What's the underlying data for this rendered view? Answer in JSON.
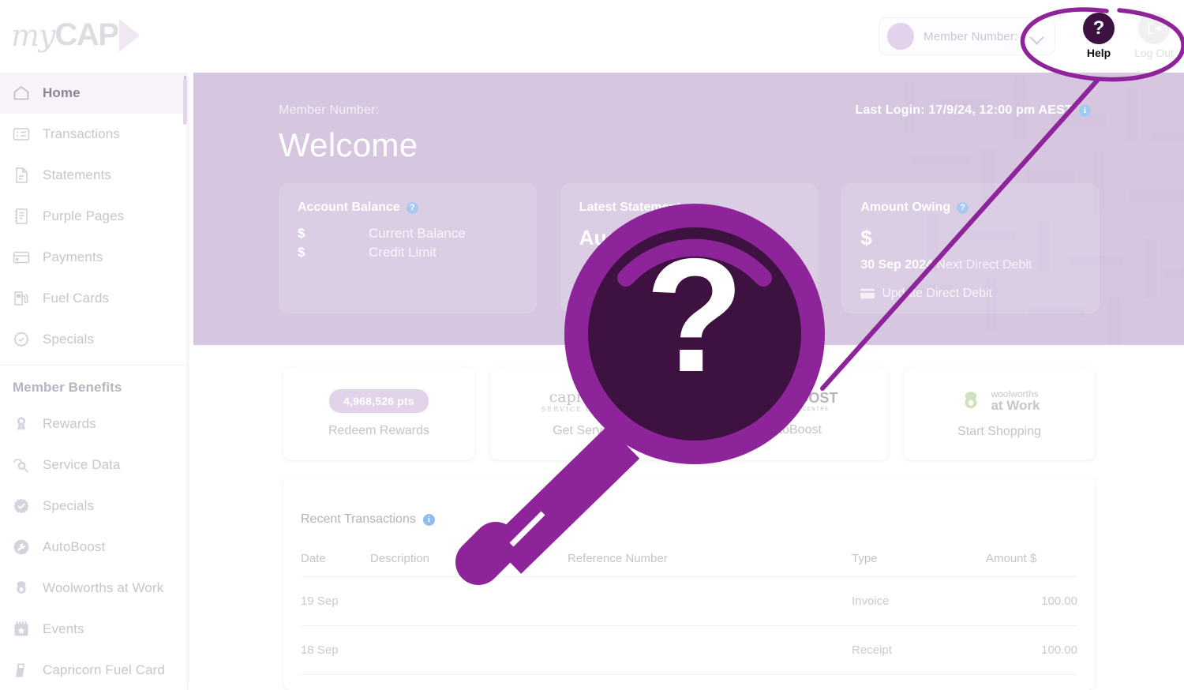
{
  "brand": {
    "logo_my": "my",
    "logo_cap": "CAP",
    "logo_chevron_icon": "chevron-right-icon"
  },
  "header": {
    "member_select": {
      "placeholder": "Member Number:",
      "value": "",
      "chevron_icon": "chevron-down-icon",
      "avatar_icon": "avatar-icon"
    },
    "help": {
      "label": "Help",
      "glyph": "?",
      "icon": "question-mark-icon"
    },
    "logout": {
      "label": "Log Out",
      "icon": "logout-icon"
    }
  },
  "sidebar": {
    "items": [
      {
        "label": "Home",
        "icon": "home-icon",
        "active": true
      },
      {
        "label": "Transactions",
        "icon": "transactions-icon",
        "active": false
      },
      {
        "label": "Statements",
        "icon": "statements-icon",
        "active": false
      },
      {
        "label": "Purple Pages",
        "icon": "purple-pages-icon",
        "active": false
      },
      {
        "label": "Payments",
        "icon": "payments-card-icon",
        "active": false
      },
      {
        "label": "Fuel Cards",
        "icon": "fuel-pump-icon",
        "active": false
      },
      {
        "label": "Specials",
        "icon": "specials-badge-icon",
        "active": false
      }
    ],
    "section_title": "Member Benefits",
    "benefits": [
      {
        "label": "Rewards",
        "icon": "rewards-ribbon-icon"
      },
      {
        "label": "Service Data",
        "icon": "service-data-icon"
      },
      {
        "label": "Specials",
        "icon": "specials-check-icon"
      },
      {
        "label": "AutoBoost",
        "icon": "wrench-icon"
      },
      {
        "label": "Woolworths at Work",
        "icon": "woolworths-icon"
      },
      {
        "label": "Events",
        "icon": "calendar-star-icon"
      },
      {
        "label": "Capricorn Fuel Card",
        "icon": "fuel-card-icon"
      }
    ]
  },
  "banner": {
    "member_number_label": "Member Number:",
    "welcome": "Welcome",
    "last_login": "Last Login: 17/9/24, 12:00 pm AEST",
    "last_login_info_icon": "info-icon",
    "cards": [
      {
        "title": "Account Balance",
        "info_icon": "question-info-icon",
        "rows": [
          {
            "symbol": "$",
            "label": "Current Balance"
          },
          {
            "symbol": "$",
            "label": "Credit Limit"
          }
        ]
      },
      {
        "title": "Latest Statement",
        "value": "August 2024"
      },
      {
        "title": "Amount Owing",
        "info_icon": "question-info-icon",
        "symbol": "$",
        "due_date": "30 Sep 2024",
        "due_label": "Next Direct Debit",
        "action_label": "Update Direct Debit",
        "action_icon": "credit-card-icon"
      }
    ]
  },
  "quick_actions": [
    {
      "badge": "4,968,526 pts",
      "label": "Redeem Rewards",
      "icon": "points-badge"
    },
    {
      "brand": "capricorn",
      "brand_sub": "SERVICE CENTRES",
      "label": "Get Service",
      "icon": "capricorn-logo"
    },
    {
      "brand": "AUTOBOOST",
      "brand_sub": "AUTO REPAIR CENTRE",
      "label": "AutoBoost",
      "icon": "autoboost-logo"
    },
    {
      "brand": "woolworths",
      "brand_sub": "at Work",
      "label": "Start Shopping",
      "icon": "woolworths-logo"
    }
  ],
  "transactions": {
    "title": "Recent Transactions",
    "info_icon": "info-icon",
    "columns": [
      "Date",
      "Description",
      "Reference Number",
      "Type",
      "Amount $"
    ],
    "rows": [
      {
        "date": "19 Sep",
        "description": "",
        "reference": "",
        "type": "Invoice",
        "amount": "100.00"
      },
      {
        "date": "18 Sep",
        "description": "",
        "reference": "",
        "type": "Receipt",
        "amount": "100.00"
      }
    ]
  },
  "annotation": {
    "magnifier_glyph": "?",
    "magnifier_icon": "magnifier-question-icon",
    "ellipse_icon": "hand-drawn-ellipse",
    "pointer_icon": "pointer-line"
  },
  "colors": {
    "brand_purple": "#8E2499",
    "dark_purple": "#3D1140",
    "banner_bg": "#D6C6E0",
    "accent_pill": "#E2D2EA",
    "info_blue": "#8FBDF0"
  }
}
